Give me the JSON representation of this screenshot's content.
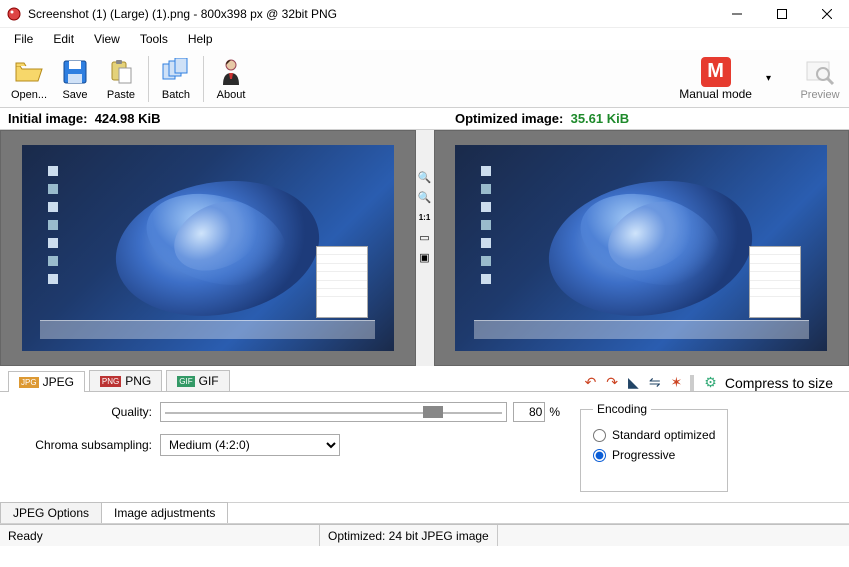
{
  "title": "Screenshot (1) (Large) (1).png - 800x398 px @ 32bit PNG",
  "menubar": {
    "file": "File",
    "edit": "Edit",
    "view": "View",
    "tools": "Tools",
    "help": "Help"
  },
  "toolbar": {
    "open": "Open...",
    "save": "Save",
    "paste": "Paste",
    "batch": "Batch",
    "about": "About",
    "mode_label": "Manual mode",
    "mode_letter": "M",
    "preview": "Preview"
  },
  "sizebar": {
    "initial_label": "Initial image:",
    "initial_value": "424.98 KiB",
    "optimized_label": "Optimized image:",
    "optimized_value": "35.61 KiB"
  },
  "mid_tools": {
    "zoom_in": "+",
    "zoom_out": "−",
    "one_to_one": "1:1"
  },
  "format_tabs": {
    "jpeg": "JPEG",
    "png": "PNG",
    "gif": "GIF"
  },
  "actions": {
    "compress": "Compress to size"
  },
  "settings": {
    "quality_label": "Quality:",
    "quality_value": "80",
    "quality_pct": "%",
    "chroma_label": "Chroma subsampling:",
    "chroma_value": "Medium (4:2:0)"
  },
  "encoding": {
    "legend": "Encoding",
    "standard": "Standard optimized",
    "progressive": "Progressive",
    "selected": "progressive"
  },
  "bottom_tabs": {
    "jpeg_options": "JPEG Options",
    "image_adj": "Image adjustments"
  },
  "statusbar": {
    "ready": "Ready",
    "optimized": "Optimized: 24 bit JPEG image"
  }
}
